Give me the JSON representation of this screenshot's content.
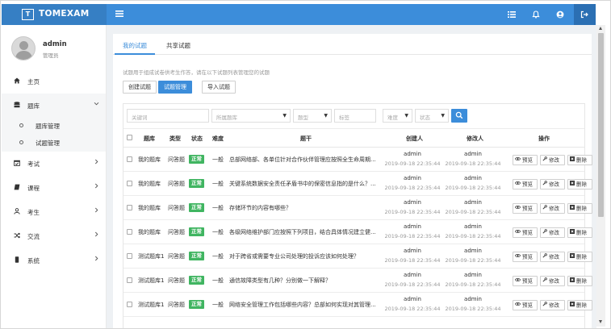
{
  "brand": {
    "logo_text": "T",
    "name": "TOMEXAM"
  },
  "topbar": {
    "icons": [
      "menu-icon",
      "list-icon",
      "bell-icon",
      "user-icon",
      "logout-icon"
    ]
  },
  "user": {
    "name": "admin",
    "role": "管理员"
  },
  "nav": {
    "items": [
      {
        "label": "主页",
        "icon": "home-icon"
      },
      {
        "label": "题库",
        "icon": "database-icon",
        "open": true
      },
      {
        "label": "考试",
        "icon": "calendar-check-icon"
      },
      {
        "label": "课程",
        "icon": "book-icon"
      },
      {
        "label": "考生",
        "icon": "user-outline-icon"
      },
      {
        "label": "交流",
        "icon": "shuffle-icon"
      },
      {
        "label": "系统",
        "icon": "mobile-icon"
      }
    ],
    "sub_items": [
      "题库管理",
      "试题管理"
    ]
  },
  "tabs": [
    "我的试题",
    "共享试题"
  ],
  "hint": "试题用于组成试卷供考生作答，请在以下试题列表管理您的试题",
  "buttons": {
    "create_bank": "创建试题",
    "manage": "试题管理",
    "import": "导入试题"
  },
  "filters": {
    "keyword_placeholder": "关键词",
    "bank_placeholder": "所属题库",
    "type_placeholder": "题型",
    "tag_placeholder": "标签",
    "difficulty_placeholder": "难度",
    "status_placeholder": "状态"
  },
  "table": {
    "headers": [
      "题库",
      "类型",
      "状态",
      "难度",
      "题干",
      "创建人",
      "修改人",
      "操作"
    ],
    "actions": {
      "preview": "预览",
      "edit": "修改",
      "delete": "删除"
    },
    "rows": [
      {
        "bank": "我的题库",
        "type": "问答题",
        "status": "正常",
        "difficulty": "一般",
        "stem": "总部网络部、各单位针对合作伙伴管理应按照全生命周期...",
        "creator": "admin",
        "created": "2019-09-18 22:35:44",
        "modifier": "admin",
        "modified": "2019-09-18 22:35:44"
      },
      {
        "bank": "我的题库",
        "type": "问答题",
        "status": "正常",
        "difficulty": "一般",
        "stem": "关键系统数据安全责任矛盾书中的保密信息指的是什么？...",
        "creator": "admin",
        "created": "2019-09-18 22:35:44",
        "modifier": "admin",
        "modified": "2019-09-18 22:35:44"
      },
      {
        "bank": "我的题库",
        "type": "问答题",
        "status": "正常",
        "difficulty": "一般",
        "stem": "存储环节的内容有哪些？",
        "creator": "admin",
        "created": "2019-09-18 22:35:44",
        "modifier": "admin",
        "modified": "2019-09-18 22:35:44"
      },
      {
        "bank": "我的题库",
        "type": "问答题",
        "status": "正常",
        "difficulty": "一般",
        "stem": "各级网络维护部门应按照下列项目，结合具体情况建立健...",
        "creator": "admin",
        "created": "2019-09-18 22:35:44",
        "modifier": "admin",
        "modified": "2019-09-18 22:35:44"
      },
      {
        "bank": "测试题库1",
        "type": "问答题",
        "status": "正常",
        "difficulty": "一般",
        "stem": "对于跨省或需要专业公司处理的投诉应该如何处理？",
        "creator": "admin",
        "created": "2019-09-18 22:35:44",
        "modifier": "admin",
        "modified": "2019-09-18 22:35:44"
      },
      {
        "bank": "测试题库1",
        "type": "问答题",
        "status": "正常",
        "difficulty": "一般",
        "stem": "通信故障类型有几种？分别做一下解释？",
        "creator": "admin",
        "created": "2019-09-18 22:35:44",
        "modifier": "admin",
        "modified": "2019-09-18 22:35:44"
      },
      {
        "bank": "测试题库1",
        "type": "问答题",
        "status": "正常",
        "difficulty": "一般",
        "stem": "网络安全管理工作包括哪些内容？总部如何实现对其管理...",
        "creator": "admin",
        "created": "2019-09-18 22:35:44",
        "modifier": "admin",
        "modified": "2019-09-18 22:35:44"
      }
    ]
  },
  "colors": {
    "primary": "#3c8dda",
    "brand_bg": "#367fc4",
    "success": "#40b561",
    "logout_bg": "#2b6fb3"
  }
}
